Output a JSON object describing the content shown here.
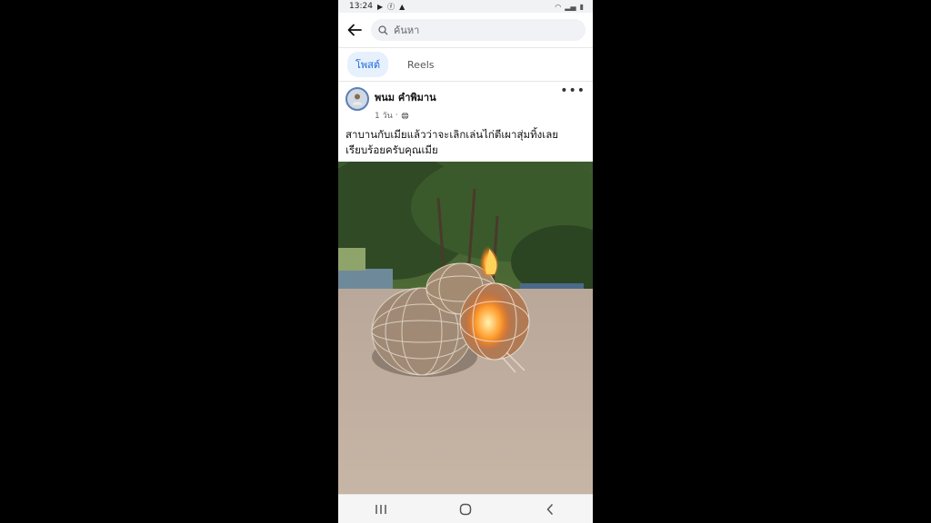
{
  "status": {
    "time": "13:24"
  },
  "search": {
    "placeholder": "ค้นหา"
  },
  "tabs": [
    {
      "label": "โพสต์",
      "active": true
    },
    {
      "label": "Reels",
      "active": false
    }
  ],
  "post": {
    "author": "พนม คำพิมาน",
    "time": "1 วัน",
    "text_line1": "สาบานกับเมียแล้วว่าจะเลิกเล่นไก่ตีเผาสุ่มทิ้งเลย",
    "text_line2": "เรียบร้อยครับคุณเมีย"
  },
  "colors": {
    "accent": "#1a6ad8",
    "tab_bg": "#e7f0fd"
  }
}
